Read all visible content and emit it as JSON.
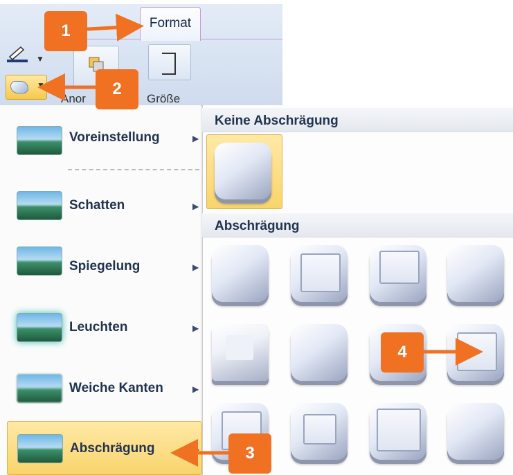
{
  "ribbon": {
    "tab_format": "Format",
    "arrange_label": "Anor",
    "size_label": "Größe"
  },
  "menu": {
    "items": [
      {
        "label": "Voreinstellung",
        "arrow": "▶"
      },
      {
        "label": "Schatten",
        "arrow": "▶"
      },
      {
        "label": "Spiegelung",
        "arrow": "▶"
      },
      {
        "label": "Leuchten",
        "arrow": "▶"
      },
      {
        "label": "Weiche Kanten",
        "arrow": "▶"
      },
      {
        "label": "Abschrägung",
        "arrow": "▶"
      }
    ]
  },
  "submenu": {
    "no_bevel_header": "Keine Abschrägung",
    "bevel_header": "Abschrägung"
  },
  "callouts": {
    "c1": "1",
    "c2": "2",
    "c3": "3",
    "c4": "4"
  },
  "colors": {
    "accent": "#f07122",
    "highlight": "#f9d46c"
  }
}
